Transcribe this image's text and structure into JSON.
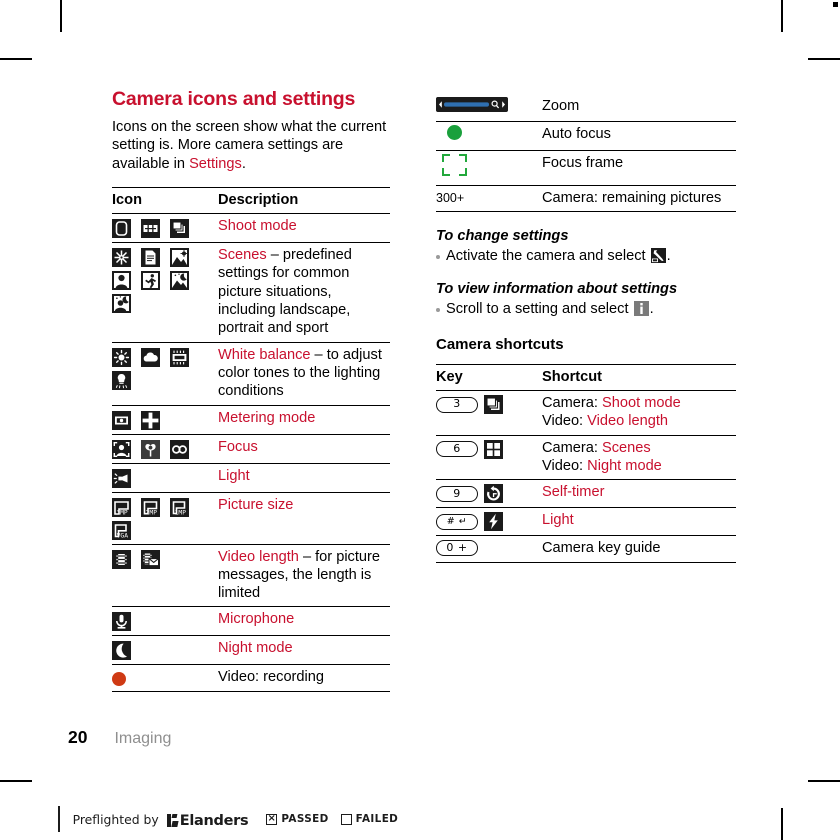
{
  "document": {
    "section_title": "Camera icons and settings",
    "intro_part1": "Icons on the screen show what the current setting is. More camera settings are available in ",
    "intro_link": "Settings",
    "intro_part2": "."
  },
  "icons_table": {
    "header_icon": "Icon",
    "header_description": "Description",
    "rows": [
      {
        "icons": [
          "shoot-mode-normal-icon",
          "shoot-mode-panorama-icon",
          "shoot-mode-burst-icon"
        ],
        "label": "Shoot mode",
        "label_color": "#c8102e",
        "detail": ""
      },
      {
        "icons": [
          "scene-snow-icon",
          "scene-document-icon",
          "scene-landscape-icon",
          "scene-portrait-icon",
          "scene-sport-icon",
          "scene-twilight-landscape-icon",
          "scene-twilight-portrait-icon"
        ],
        "label": "Scenes",
        "label_color": "#c8102e",
        "detail": " – predefined settings for common picture situations, including landscape, portrait and sport"
      },
      {
        "icons": [
          "wb-daylight-icon",
          "wb-cloudy-icon",
          "wb-fluorescent-icon",
          "wb-incandescent-icon"
        ],
        "label": "White balance",
        "label_color": "#c8102e",
        "detail": " – to adjust color tones to the lighting conditions"
      },
      {
        "icons": [
          "metering-spot-icon",
          "metering-normal-icon"
        ],
        "label": "Metering mode",
        "label_color": "#c8102e",
        "detail": ""
      },
      {
        "icons": [
          "focus-face-detection-icon",
          "focus-macro-icon",
          "focus-infinity-icon"
        ],
        "label": "Focus",
        "label_color": "#c8102e",
        "detail": ""
      },
      {
        "icons": [
          "light-icon"
        ],
        "label": "Light",
        "label_color": "#c8102e",
        "detail": ""
      },
      {
        "icons": [
          "picsize-3mp-icon",
          "picsize-2mp-icon",
          "picsize-1mp-icon",
          "picsize-vga-icon"
        ],
        "label": "Picture size",
        "label_color": "#c8102e",
        "detail": ""
      },
      {
        "icons": [
          "video-length-icon",
          "video-message-length-icon"
        ],
        "label": "Video length",
        "label_color": "#c8102e",
        "detail": " – for picture messages, the length is limited"
      },
      {
        "icons": [
          "microphone-icon"
        ],
        "label": "Microphone",
        "label_color": "#c8102e",
        "detail": ""
      },
      {
        "icons": [
          "night-mode-icon"
        ],
        "label": "Night mode",
        "label_color": "#c8102e",
        "detail": ""
      },
      {
        "icons": [
          "recording-dot-icon"
        ],
        "label": "Video: recording",
        "label_color": "#000000",
        "detail": ""
      }
    ]
  },
  "status_table": {
    "rows": [
      {
        "icon": "zoom-slider-icon",
        "label": "Zoom"
      },
      {
        "icon": "auto-focus-dot-icon",
        "label": "Auto focus"
      },
      {
        "icon": "focus-frame-icon",
        "label": "Focus frame"
      },
      {
        "icon": "remaining-pictures-count",
        "icon_text": "300+",
        "label": "Camera: remaining pictures"
      }
    ]
  },
  "howto": {
    "change_settings_heading": "To change settings",
    "change_settings_text_before": "Activate the camera and select ",
    "change_settings_icon": "settings-wrench-icon",
    "change_settings_text_after": ".",
    "view_info_heading": "To view information about settings",
    "view_info_text_before": "Scroll to a setting and select ",
    "view_info_icon": "information-icon",
    "view_info_text_after": "."
  },
  "shortcuts": {
    "heading": "Camera shortcuts",
    "header_key": "Key",
    "header_shortcut": "Shortcut",
    "rows": [
      {
        "key_label": "3",
        "key_icon": "shoot-mode-burst-icon",
        "lines": [
          {
            "prefix": "Camera: ",
            "link": "Shoot mode"
          },
          {
            "prefix": "Video: ",
            "link": "Video length"
          }
        ]
      },
      {
        "key_label": "6",
        "key_icon": "scenes-grid-icon",
        "lines": [
          {
            "prefix": "Camera: ",
            "link": "Scenes"
          },
          {
            "prefix": "Video: ",
            "link": "Night mode"
          }
        ]
      },
      {
        "key_label": "9",
        "key_icon": "self-timer-icon",
        "lines": [
          {
            "prefix": "",
            "link": "Self-timer"
          }
        ]
      },
      {
        "key_label": "#  ↵",
        "key_icon": "light-flash-icon",
        "lines": [
          {
            "prefix": "",
            "link": "Light"
          }
        ]
      },
      {
        "key_label": "0 +",
        "key_icon": "",
        "lines": [
          {
            "prefix": "Camera key guide",
            "link": ""
          }
        ]
      }
    ]
  },
  "footer": {
    "page_number": "20",
    "chapter": "Imaging"
  },
  "preflight": {
    "label": "Preflighted by",
    "brand": "Elanders",
    "passed_label": "PASSED",
    "passed_mark": "×",
    "failed_label": "FAILED",
    "failed_mark": ""
  },
  "colors": {
    "accent_red": "#c8102e",
    "green": "#1aa03c",
    "record_orange": "#cf3a14",
    "chapter_grey": "#8f8f8f"
  }
}
